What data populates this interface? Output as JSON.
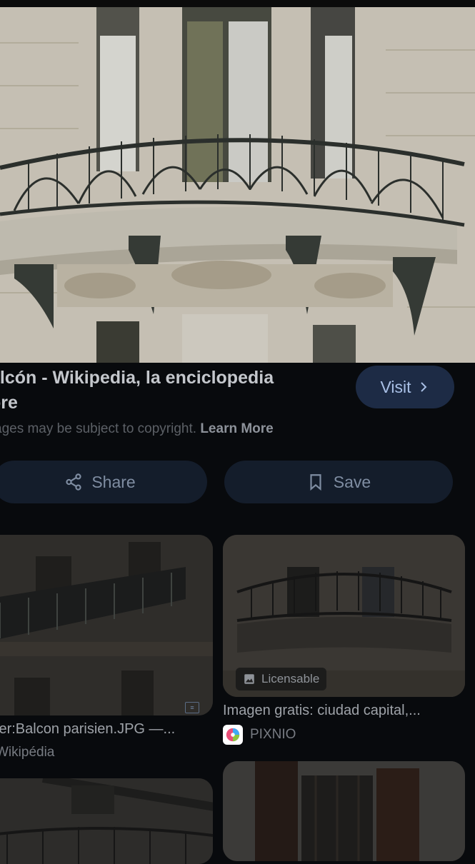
{
  "result": {
    "title_line1": "alcón - Wikipedia, la enciclopedia",
    "title_line2": "ore",
    "visit_label": "Visit",
    "copyright_text": "ages may be subject to copyright.",
    "learn_more": "Learn More",
    "share_label": "Share",
    "save_label": "Save"
  },
  "related": [
    {
      "title": "ier:Balcon parisien.JPG —...",
      "source": "Wikipédia"
    },
    {
      "title": "Imagen gratis: ciudad capital,...",
      "source": "PIXNIO",
      "badge": "Licensable"
    },
    {
      "title": "",
      "source": ""
    },
    {
      "title": "",
      "source": ""
    }
  ],
  "icons": {
    "visit": "chevron-right-icon",
    "share": "share-icon",
    "save": "bookmark-icon",
    "licensable": "image-icon",
    "source_logo": "pixnio-logo-icon"
  },
  "colors": {
    "background": "#080a0d",
    "visit_button": "#1d2b45",
    "pill_button": "#141d2b",
    "link": "#a9c0e6"
  }
}
